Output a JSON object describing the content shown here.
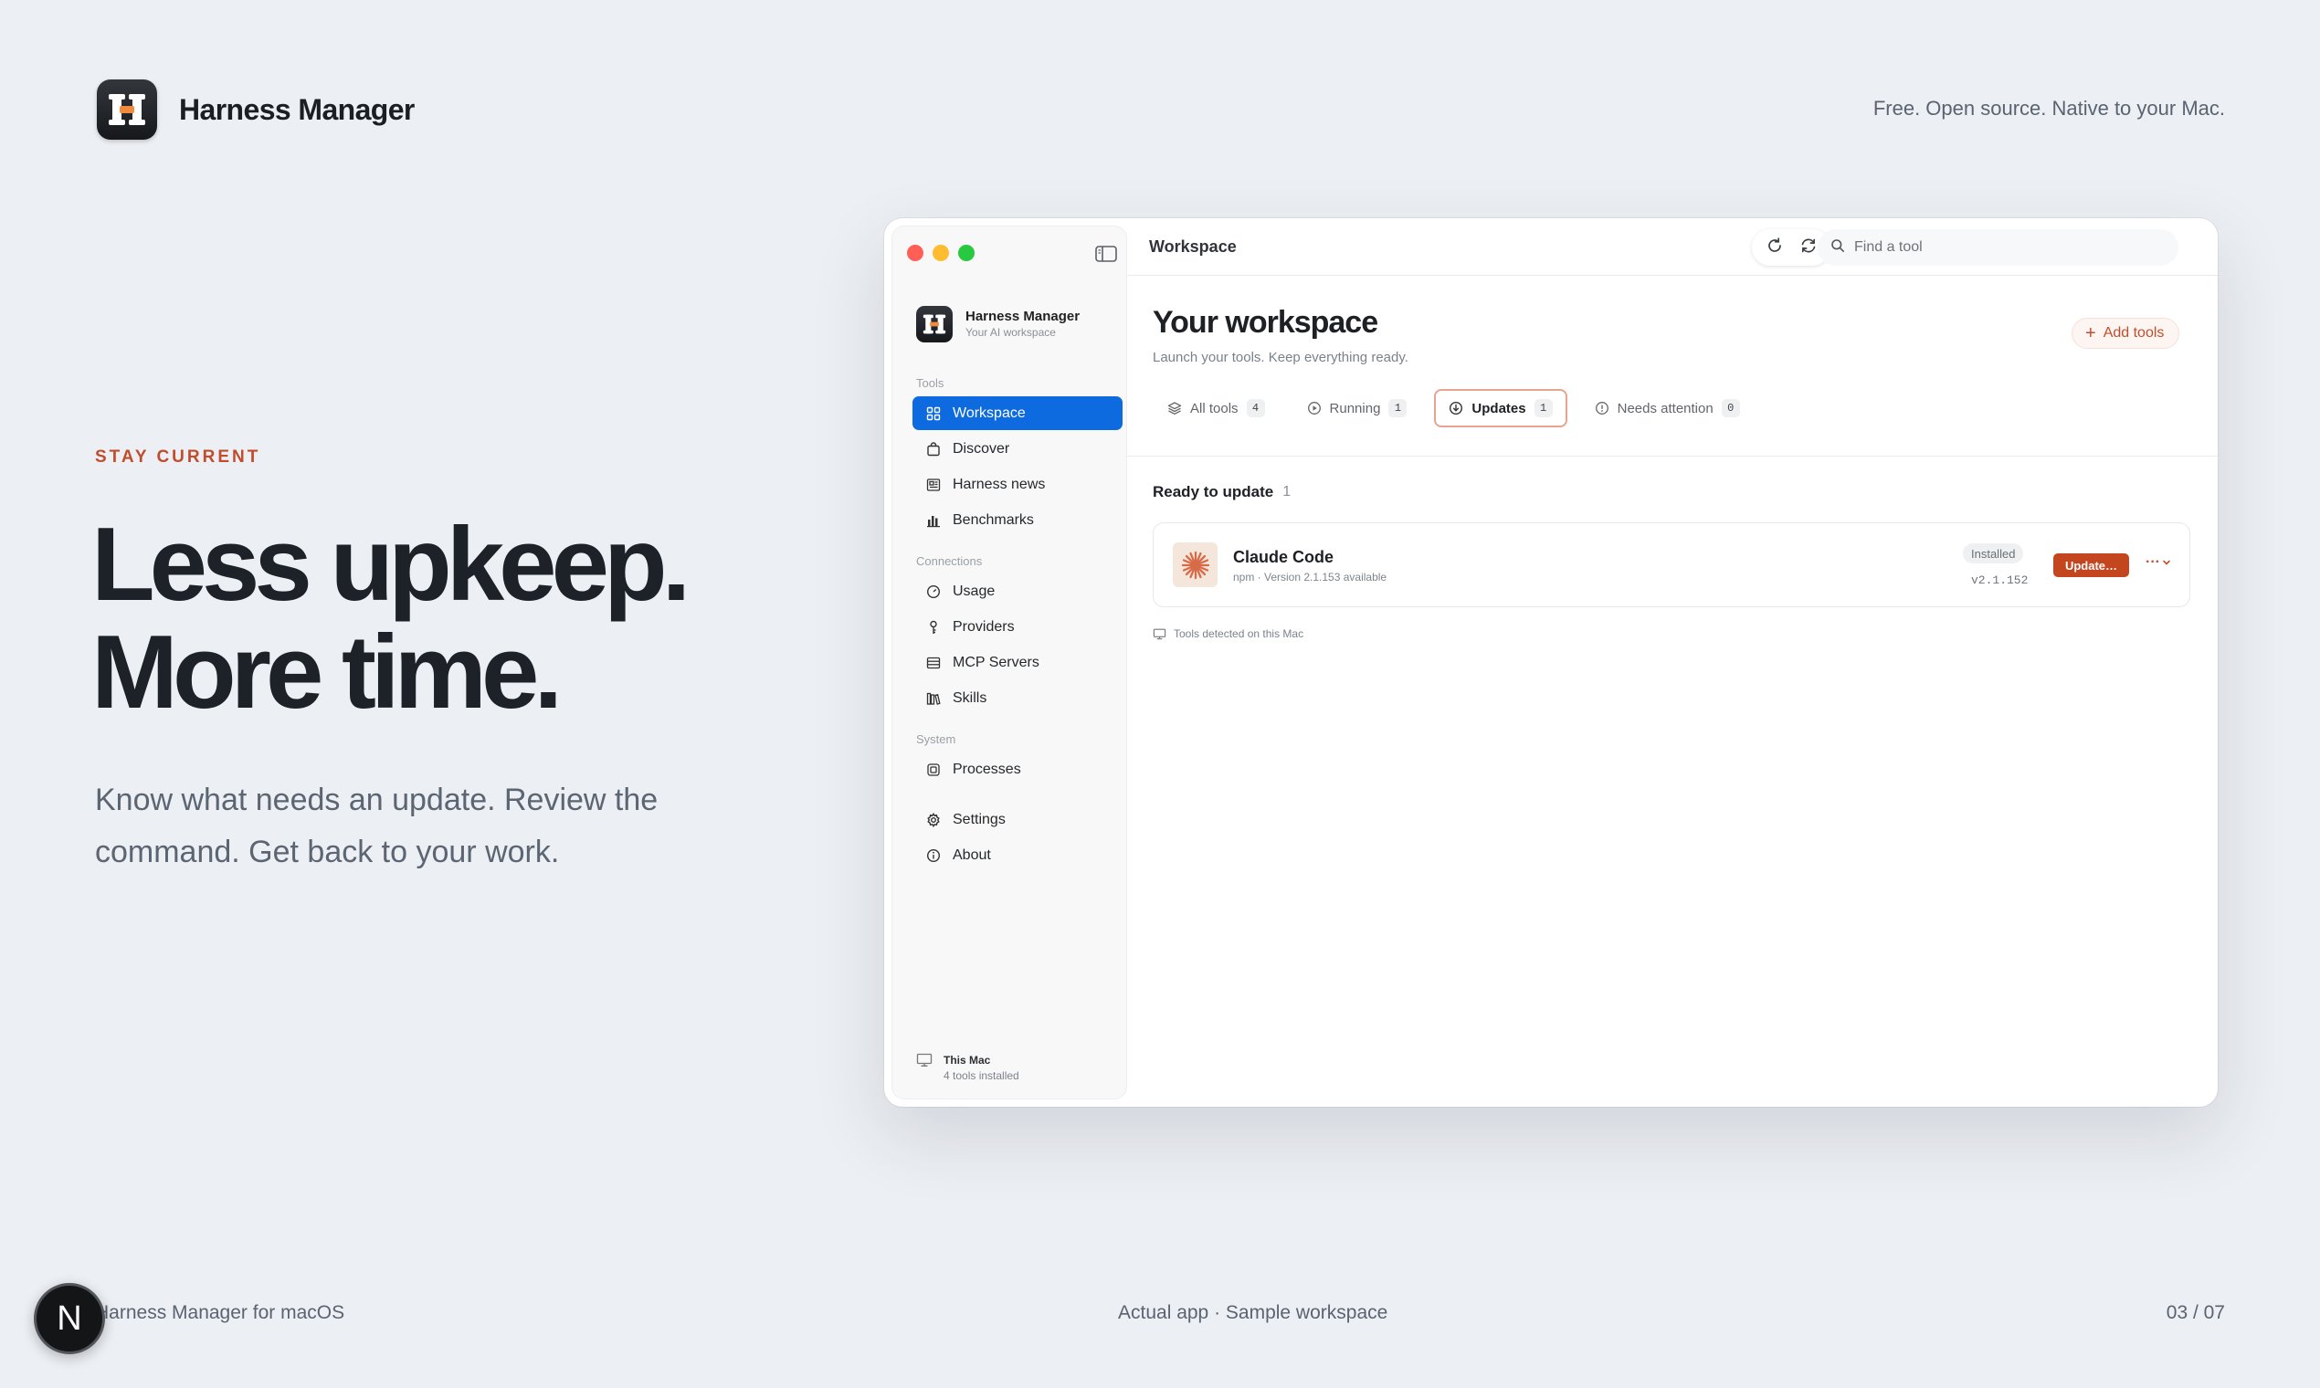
{
  "slide": {
    "brand_name": "Harness Manager",
    "tagline": "Free. Open source. Native to your Mac.",
    "eyebrow": "STAY CURRENT",
    "headline_line1": "Less upkeep.",
    "headline_line2": "More time.",
    "subcopy": "Know what needs an update. Review the command. Get back to your work.",
    "footer_left": "Harness Manager for macOS",
    "footer_center": "Actual app · Sample workspace",
    "footer_right": "03 / 07",
    "badge_letter": "N"
  },
  "colors": {
    "accent": "#c14d2c",
    "selection": "#0e6adf",
    "logo_orange": "#f08a3c"
  },
  "app": {
    "name": "Harness Manager",
    "subtitle": "Your AI workspace",
    "breadcrumb": "Workspace",
    "search_placeholder": "Find a tool",
    "sidebar": {
      "sections": {
        "tools": "Tools",
        "connections": "Connections",
        "system": "System"
      },
      "items": [
        {
          "label": "Workspace",
          "icon": "grid-icon"
        },
        {
          "label": "Discover",
          "icon": "bag-icon"
        },
        {
          "label": "Harness news",
          "icon": "newspaper-icon"
        },
        {
          "label": "Benchmarks",
          "icon": "bar-chart-icon"
        },
        {
          "label": "Usage",
          "icon": "gauge-icon"
        },
        {
          "label": "Providers",
          "icon": "key-icon"
        },
        {
          "label": "MCP Servers",
          "icon": "server-icon"
        },
        {
          "label": "Skills",
          "icon": "books-icon"
        },
        {
          "label": "Processes",
          "icon": "cpu-icon"
        },
        {
          "label": "Settings",
          "icon": "gear-icon"
        },
        {
          "label": "About",
          "icon": "info-icon"
        }
      ],
      "footer_title": "This Mac",
      "footer_sub": "4 tools installed"
    },
    "main": {
      "title": "Your workspace",
      "subtitle": "Launch your tools. Keep everything ready.",
      "add_tools": "Add tools",
      "tabs": [
        {
          "label": "All tools",
          "count": "4"
        },
        {
          "label": "Running",
          "count": "1"
        },
        {
          "label": "Updates",
          "count": "1"
        },
        {
          "label": "Needs attention",
          "count": "0"
        }
      ],
      "section_title": "Ready to update",
      "section_count": "1",
      "tool": {
        "name": "Claude Code",
        "meta": "npm · Version 2.1.153 available",
        "status": "Installed",
        "version": "v2.1.152",
        "update_label": "Update…",
        "more_label": "···"
      },
      "detected_note": "Tools detected on this Mac"
    }
  }
}
